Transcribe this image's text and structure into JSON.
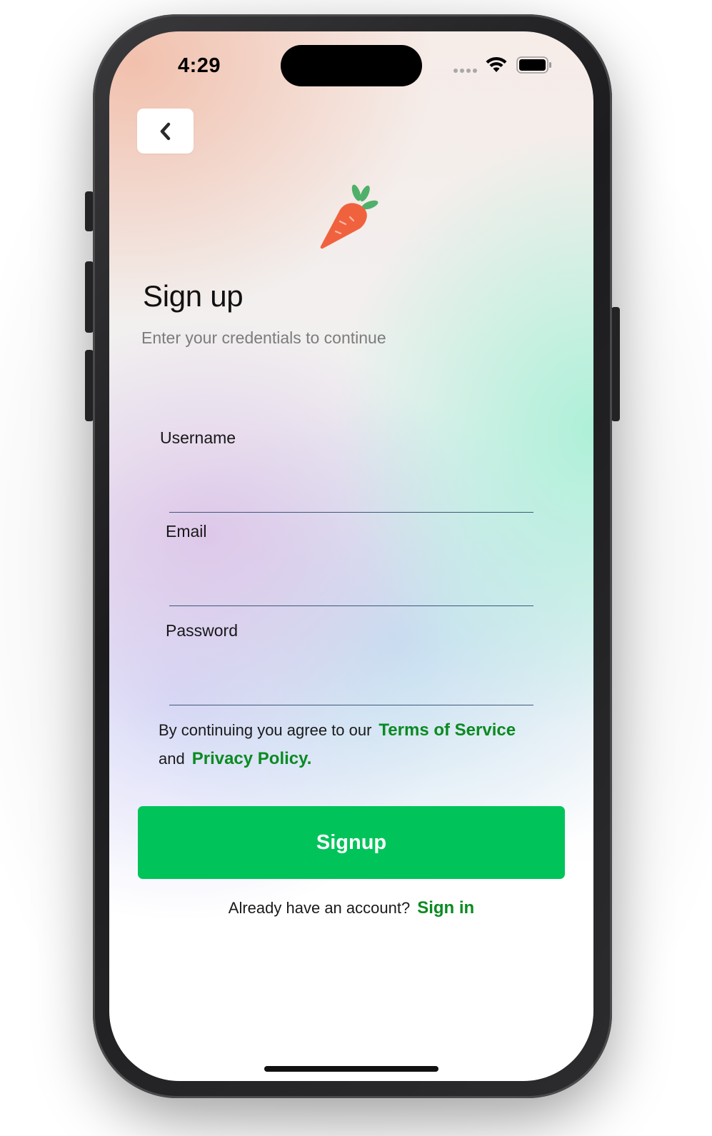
{
  "status_bar": {
    "time": "4:29"
  },
  "header": {
    "back_icon": "chevron-left-icon"
  },
  "logo": {
    "icon": "carrot-icon",
    "body_color": "#f0623e",
    "leaf_color": "#4fb06a"
  },
  "main": {
    "title": "Sign up",
    "subtitle": "Enter your credentials to continue"
  },
  "form": {
    "username": {
      "label": "Username",
      "value": ""
    },
    "email": {
      "label": "Email",
      "value": ""
    },
    "password": {
      "label": "Password",
      "value": ""
    }
  },
  "terms": {
    "prefix": "By continuing you agree to our",
    "terms_link": "Terms of Service",
    "connector": "and",
    "privacy_link": "Privacy Policy."
  },
  "actions": {
    "signup_label": "Signup"
  },
  "footer": {
    "prompt": "Already have an account?",
    "signin_link": "Sign in"
  },
  "colors": {
    "accent": "#00c45a",
    "link": "#0a8a21",
    "input_underline": "#3d5a78"
  }
}
